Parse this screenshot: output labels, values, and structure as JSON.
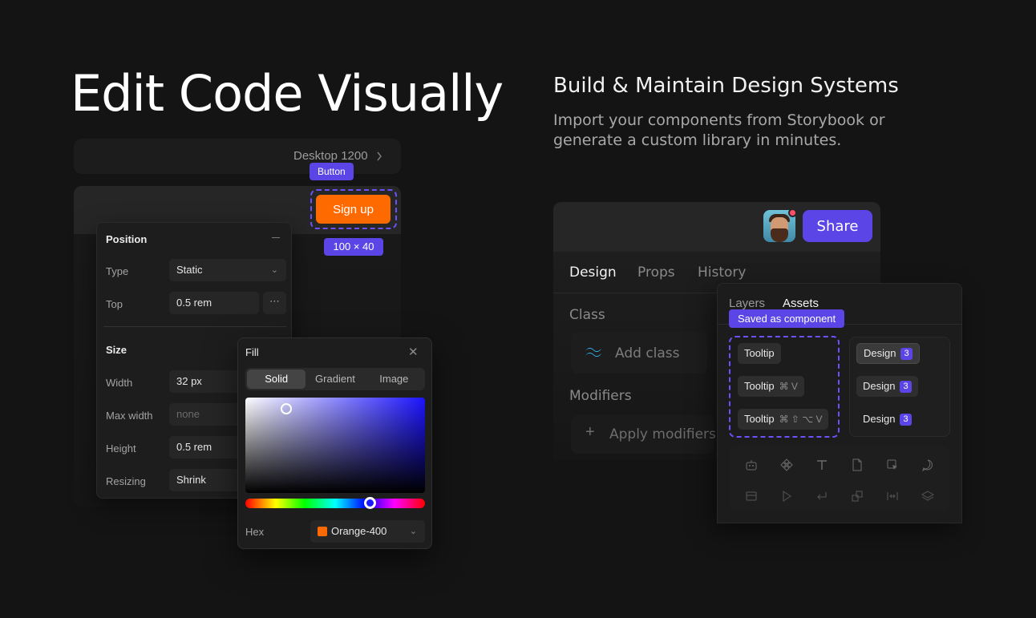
{
  "left": {
    "title": "Edit Code Visually",
    "breadcrumb": {
      "label": "Desktop 1200",
      "chevron_icon": "chevron-right-icon"
    },
    "selected_tag": "Button",
    "signup_label": "Sign up",
    "size_tag": "100 × 40",
    "position_panel": {
      "title": "Position",
      "type_label": "Type",
      "type_value": "Static",
      "top_label": "Top",
      "top_value": "0.5 rem",
      "more": "⋯",
      "size_title": "Size",
      "width_label": "Width",
      "width_value": "32 px",
      "maxwidth_label": "Max width",
      "maxwidth_value": "none",
      "height_label": "Height",
      "height_value": "0.5 rem",
      "resizing_label": "Resizing",
      "resizing_value": "Shrink"
    },
    "fill_panel": {
      "title": "Fill",
      "close": "✕",
      "tabs": [
        "Solid",
        "Gradient",
        "Image"
      ],
      "active_tab": "Solid",
      "hex_label": "Hex",
      "hex_value": "Orange-400",
      "hex_color": "#ff6a00"
    }
  },
  "right": {
    "title": "Build & Maintain Design Systems",
    "subtitle": "Import your components from Storybook or generate a custom library in minutes.",
    "share_label": "Share",
    "tabs": [
      "Design",
      "Props",
      "History"
    ],
    "active_tab": "Design",
    "class_label": "Class",
    "add_class": "Add class",
    "modifiers_label": "Modifiers",
    "apply_modifiers": "Apply modifiers",
    "asset_tabs": [
      "Layers",
      "Assets"
    ],
    "active_asset_tab": "Assets",
    "saved_tag": "Saved as component",
    "tooltips": [
      {
        "label": "Tooltip",
        "kbd": ""
      },
      {
        "label": "Tooltip",
        "kbd": "⌘ V"
      },
      {
        "label": "Tooltip",
        "kbd": "⌘ ⇧ ⌥ V"
      }
    ],
    "design_chips": [
      {
        "label": "Design",
        "badge": "3"
      },
      {
        "label": "Design",
        "badge": "3"
      },
      {
        "label": "Design",
        "badge": "3"
      }
    ],
    "accent": "#5b45e6",
    "tool_icons": [
      "robot-icon",
      "component-icon",
      "text-icon",
      "file-icon",
      "select-icon",
      "comment-icon",
      "layout-icon",
      "play-icon",
      "return-icon",
      "grid-plus-icon",
      "spacing-icon",
      "layers-icon"
    ]
  }
}
